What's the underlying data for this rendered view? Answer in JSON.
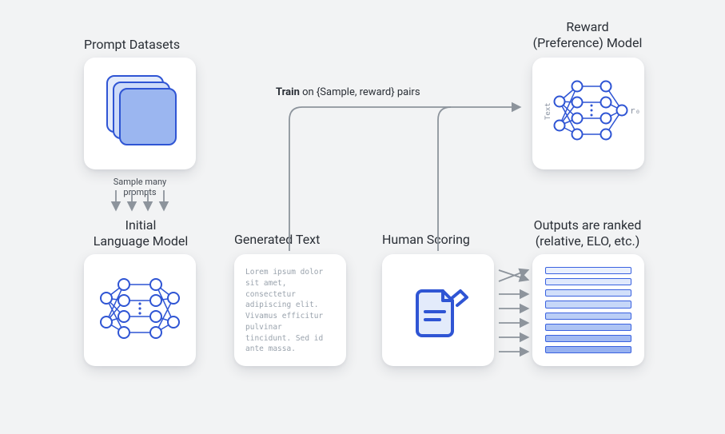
{
  "titles": {
    "prompt_datasets": "Prompt Datasets",
    "initial_lm": "Initial\nLanguage Model",
    "generated_text": "Generated Text",
    "human_scoring": "Human Scoring",
    "ranked_outputs": "Outputs are ranked\n(relative, ELO, etc.)",
    "reward_model": "Reward\n(Preference) Model"
  },
  "labels": {
    "sample_prompts": "Sample many prompts",
    "train_on_pairs_prefix": "Train",
    "train_on_pairs_rest": " on {Sample, reward} pairs"
  },
  "generated_text_body": "Lorem ipsum dolor\nsit amet,\nconsectetur\nadipiscing elit.\nVivamus efficitur\npulvinar\ntincidunt. Sed id\nante massa.",
  "reward_model_aux": {
    "side_text": "Text",
    "output_symbol": "r₀"
  },
  "ranked_bar_fills": [
    "#eaf0fd",
    "#e0e9fc",
    "#d1dffa",
    "#c6d7f8",
    "#bacef6",
    "#aec4f4",
    "#a2baf2",
    "#97b1f0"
  ],
  "colors": {
    "accent": "#2f55d4",
    "arrow": "#8d949c"
  }
}
